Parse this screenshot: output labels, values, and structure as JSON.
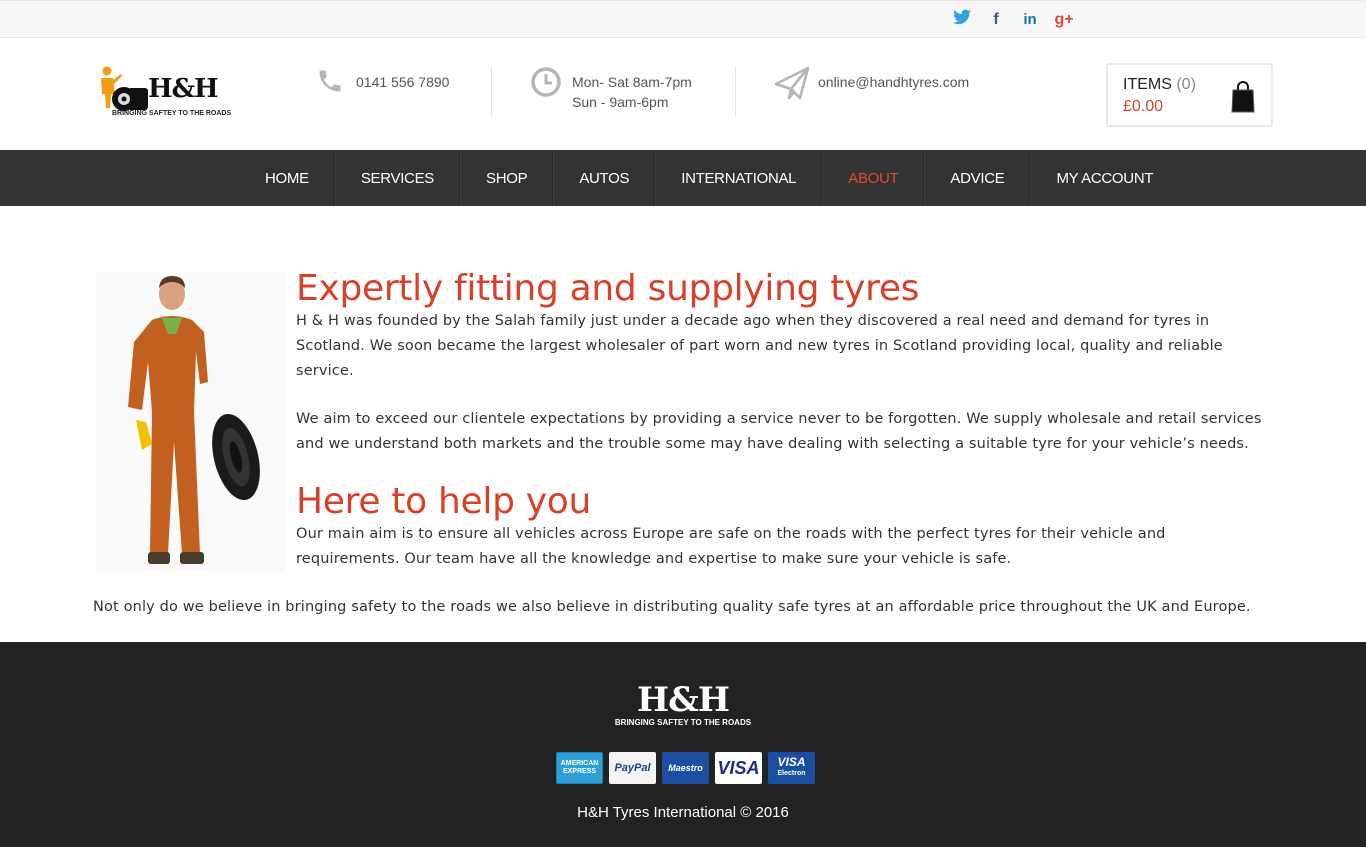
{
  "social": {
    "twitter": "t",
    "facebook": "f",
    "linkedin": "in",
    "googleplus": "g+"
  },
  "header": {
    "logo_text": "H&H",
    "logo_tagline": "BRINGING SAFTEY TO THE ROADS",
    "phone": "0141 556 7890",
    "hours_line1": "Mon- Sat 8am-7pm",
    "hours_line2": "Sun - 9am-6pm",
    "email": "online@handhtyres.com",
    "cart": {
      "items_label": "ITEMS",
      "items_count": "(0)",
      "total": "£0.00"
    }
  },
  "nav": {
    "items": [
      {
        "label": "HOME"
      },
      {
        "label": "SERVICES"
      },
      {
        "label": "SHOP"
      },
      {
        "label": "AUTOS"
      },
      {
        "label": "INTERNATIONAL"
      },
      {
        "label": "ABOUT"
      },
      {
        "label": "ADVICE"
      },
      {
        "label": "MY ACCOUNT"
      }
    ],
    "active": "ABOUT"
  },
  "main": {
    "heading1": "Expertly fitting and supplying tyres",
    "para1": "H & H was founded by the Salah family just under a decade ago when they discovered a real need and demand for tyres in Scotland. We soon became the largest wholesaler of part worn and new tyres in Scotland providing local, quality and reliable service.",
    "para2": "We aim to exceed our clientele expectations by providing a service never to be forgotten. We supply wholesale and retail services and we understand both markets and the trouble some may have dealing with selecting a suitable tyre for your vehicle’s needs.",
    "heading2": "Here to help you",
    "para3": "Our main aim is to ensure all vehicles across Europe are safe on the roads with the perfect tyres for their vehicle and requirements.  Our team have all the knowledge and expertise to make sure your vehicle is safe.",
    "para4": "Not only do we believe in bringing safety to the roads we also believe in distributing quality safe tyres at an affordable price throughout the UK and Europe."
  },
  "footer": {
    "logo_text": "H&H",
    "logo_tagline": "BRINGING SAFTEY TO THE ROADS",
    "cards": {
      "amex": "AMERICAN EXPRESS",
      "paypal": "PayPal",
      "maestro": "Maestro",
      "visa": "VISA",
      "visa_electron_top": "VISA",
      "visa_electron_bottom": "Electron"
    },
    "copyright": "H&H Tyres International © 2016"
  },
  "colors": {
    "accent": "#d9402a",
    "nav_bg": "#333333",
    "footer_bg": "#222222"
  }
}
